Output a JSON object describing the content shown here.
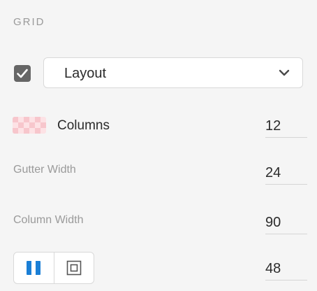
{
  "section_title": "GRID",
  "layout": {
    "checked": true,
    "select_value": "Layout"
  },
  "columns": {
    "label": "Columns",
    "value": "12",
    "swatch_colors": [
      "#f7c6cc",
      "#fde2e5"
    ]
  },
  "gutter_width": {
    "label": "Gutter Width",
    "value": "24"
  },
  "column_width": {
    "label": "Column Width",
    "value": "90"
  },
  "offset": {
    "value": "48",
    "modes": [
      {
        "icon": "column-mode-icon",
        "active": true,
        "color": "#1a7fd6"
      },
      {
        "icon": "inset-mode-icon",
        "active": false,
        "color": "#555555"
      }
    ]
  }
}
